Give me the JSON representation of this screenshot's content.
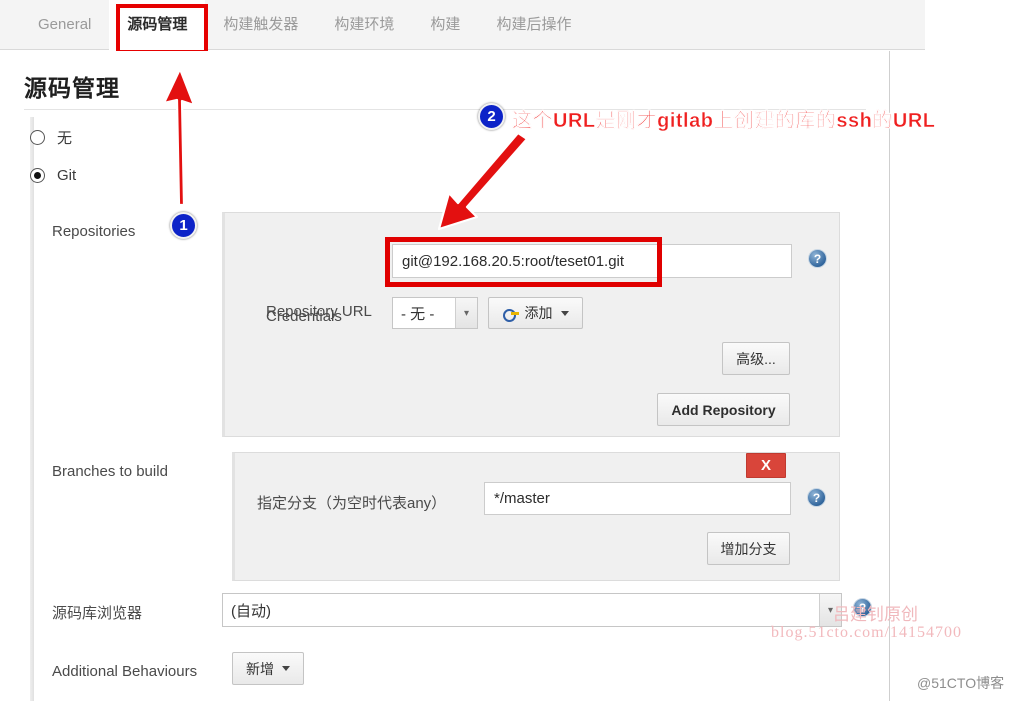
{
  "tabs": [
    {
      "label": "General",
      "active": false
    },
    {
      "label": "源码管理",
      "active": true
    },
    {
      "label": "构建触发器",
      "active": false
    },
    {
      "label": "构建环境",
      "active": false
    },
    {
      "label": "构建",
      "active": false
    },
    {
      "label": "构建后操作",
      "active": false
    }
  ],
  "page": {
    "title": "源码管理"
  },
  "scm_radios": [
    {
      "label": "无",
      "checked": false
    },
    {
      "label": "Git",
      "checked": true
    }
  ],
  "repositories": {
    "label": "Repositories",
    "repository_url_label": "Repository URL",
    "repository_url_value": "git@192.168.20.5:root/teset01.git",
    "credentials_label": "Credentials",
    "credentials_value": "- 无 -",
    "credentials_add_label": "添加",
    "advanced_label": "高级...",
    "add_repository_label": "Add Repository",
    "help_icon": "help-icon"
  },
  "branches": {
    "label": "Branches to build",
    "specifier_label": "指定分支（为空时代表any）",
    "specifier_value": "*/master",
    "add_branch_label": "增加分支",
    "delete_label": "X"
  },
  "repo_browser": {
    "label": "源码库浏览器",
    "value": "(自动)"
  },
  "additional_behaviours": {
    "label": "Additional Behaviours",
    "add_label": "新增"
  },
  "annotations": {
    "badge1": "1",
    "badge2": "2",
    "note2": "这个URL是刚才gitlab上创建的库的ssh的URL",
    "accent_red": "#e00000",
    "accent_blue": "#0d23c8"
  },
  "watermarks": {
    "author": "吕建钊原创",
    "blog": "blog.51cto.com/14154700",
    "corner": "@51CTO博客"
  }
}
